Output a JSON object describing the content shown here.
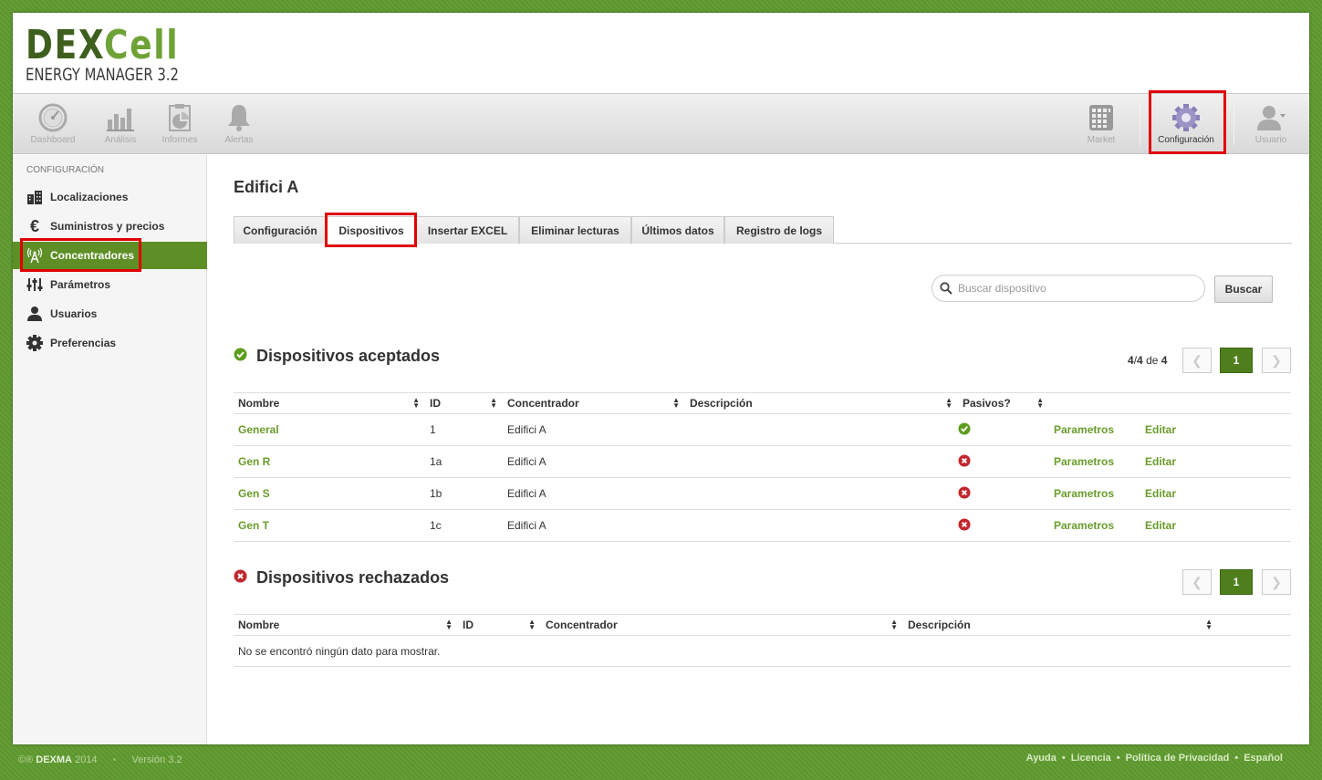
{
  "logo": {
    "main_a": "DEX",
    "main_b": "Cell",
    "sub": "ENERGY MANAGER 3.2"
  },
  "toolbar": {
    "left": [
      {
        "label": "Dashboard",
        "icon": "gauge-icon"
      },
      {
        "label": "Análisis",
        "icon": "bar-chart-icon"
      },
      {
        "label": "Informes",
        "icon": "report-icon"
      },
      {
        "label": "Alertas",
        "icon": "bell-icon"
      }
    ],
    "market": "Market",
    "config": "Configuración",
    "user": "Usuario"
  },
  "sidebar": {
    "title": "CONFIGURACIÓN",
    "items": [
      {
        "label": "Localizaciones",
        "icon": "buildings-icon"
      },
      {
        "label": "Suministros y precios",
        "icon": "euro-icon"
      },
      {
        "label": "Concentradores",
        "icon": "antenna-icon"
      },
      {
        "label": "Parámetros",
        "icon": "sliders-icon"
      },
      {
        "label": "Usuarios",
        "icon": "user-icon"
      },
      {
        "label": "Preferencias",
        "icon": "gear-icon"
      }
    ]
  },
  "main": {
    "title": "Edifici A",
    "tabs": [
      "Configuración",
      "Dispositivos",
      "Insertar EXCEL",
      "Eliminar lecturas",
      "Últimos datos",
      "Registro de logs"
    ],
    "search": {
      "placeholder": "Buscar dispositivo",
      "value": "",
      "button": "Buscar"
    },
    "accepted": {
      "title": "Dispositivos aceptados",
      "count_a": "4",
      "count_sep": "/",
      "count_b": "4",
      "count_de": "de",
      "count_total": "4",
      "page": "1",
      "headers": [
        "Nombre",
        "ID",
        "Concentrador",
        "Descripción",
        "Pasivos?"
      ],
      "rows": [
        {
          "name": "General",
          "id": "1",
          "concentrator": "Edifici A",
          "description": "",
          "passive": true,
          "params": "Parametros",
          "edit": "Editar"
        },
        {
          "name": "Gen R",
          "id": "1a",
          "concentrator": "Edifici A",
          "description": "",
          "passive": false,
          "params": "Parametros",
          "edit": "Editar"
        },
        {
          "name": "Gen S",
          "id": "1b",
          "concentrator": "Edifici A",
          "description": "",
          "passive": false,
          "params": "Parametros",
          "edit": "Editar"
        },
        {
          "name": "Gen T",
          "id": "1c",
          "concentrator": "Edifici A",
          "description": "",
          "passive": false,
          "params": "Parametros",
          "edit": "Editar"
        }
      ]
    },
    "rejected": {
      "title": "Dispositivos rechazados",
      "page": "1",
      "headers": [
        "Nombre",
        "ID",
        "Concentrador",
        "Descripción"
      ],
      "empty": "No se encontró ningún dato para mostrar."
    }
  },
  "footer": {
    "copyright": "©® ",
    "brand": "DEXMA",
    "year": " 2014",
    "version": "Versión 3.2",
    "links": [
      "Ayuda",
      "Licencia",
      "Política de Privacidad",
      "Español"
    ]
  },
  "colors": {
    "accent": "#5e8f26",
    "link": "#6a9c2c",
    "highlight": "#e00000",
    "ok": "#5e9c1e",
    "error": "#c0272d"
  }
}
